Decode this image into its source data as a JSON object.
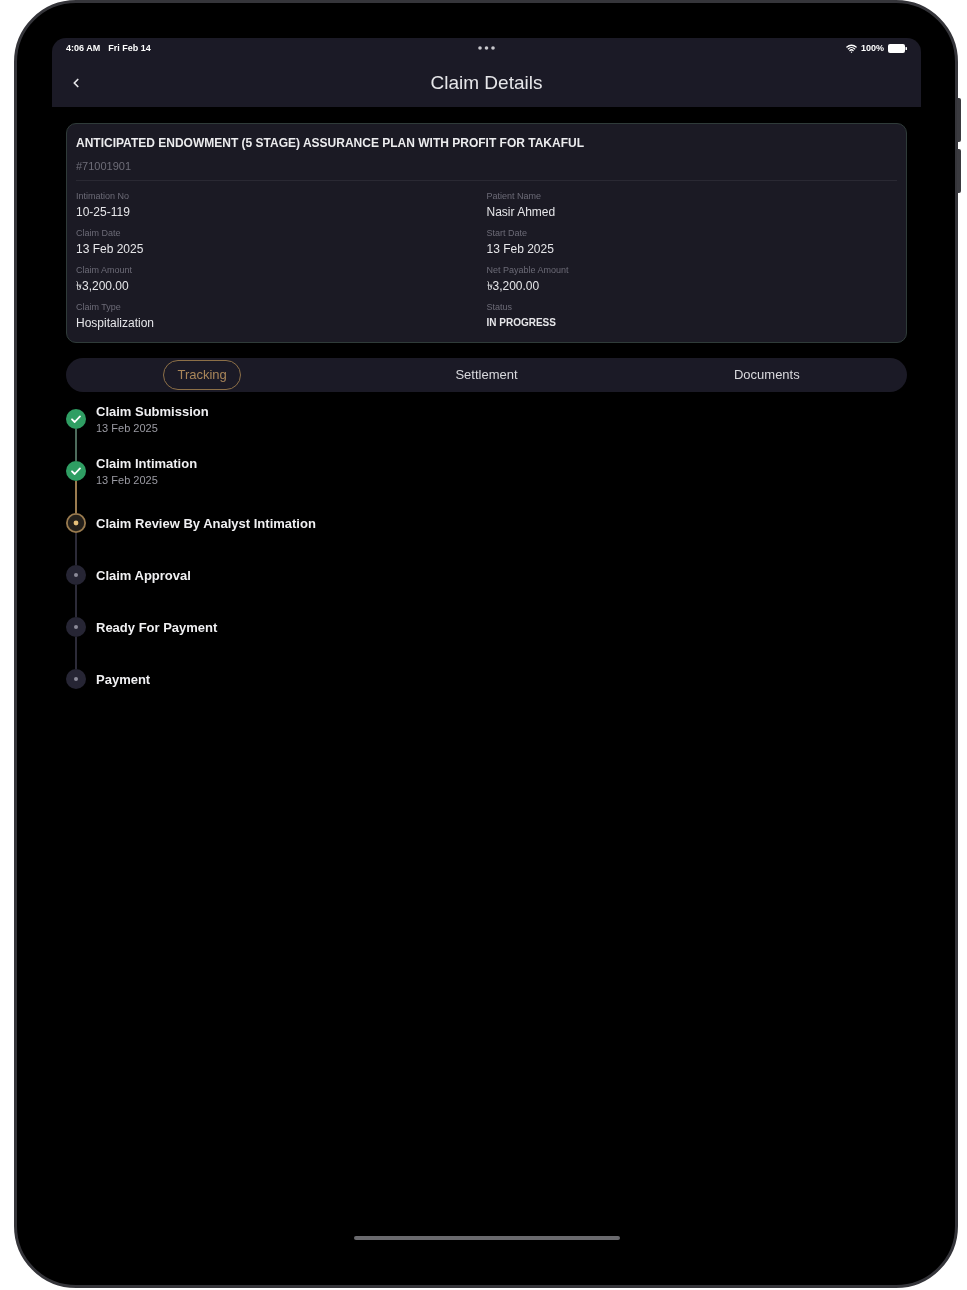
{
  "status_bar": {
    "time": "4:06 AM",
    "date": "Fri Feb 14",
    "battery": "100%"
  },
  "nav_bar": {
    "title": "Claim Details"
  },
  "claim_card": {
    "title": "ANTICIPATED ENDOWMENT (5 STAGE) ASSURANCE PLAN WITH PROFIT FOR TAKAFUL",
    "number": "#71001901",
    "fields": [
      {
        "label": "Intimation No",
        "value": "10-25-119",
        "kind": "text"
      },
      {
        "label": "Patient Name",
        "value": "Nasir Ahmed",
        "kind": "text"
      },
      {
        "label": "Claim Date",
        "value": "13 Feb 2025",
        "kind": "text"
      },
      {
        "label": "Start Date",
        "value": "13 Feb 2025",
        "kind": "text"
      },
      {
        "label": "Claim Amount",
        "value": "৳3,200.00",
        "kind": "text"
      },
      {
        "label": "Net Payable Amount",
        "value": "৳3,200.00",
        "kind": "text"
      },
      {
        "label": "Claim Type",
        "value": "Hospitalization",
        "kind": "text"
      },
      {
        "label": "Status",
        "value": "IN PROGRESS",
        "kind": "status"
      }
    ]
  },
  "tabs": [
    {
      "label": "Tracking",
      "selected": true
    },
    {
      "label": "Settlement",
      "selected": false
    },
    {
      "label": "Documents",
      "selected": false
    }
  ],
  "timeline": [
    {
      "title": "Claim Submission",
      "date": "13 Feb 2025",
      "completed": true,
      "current": false
    },
    {
      "title": "Claim Intimation",
      "date": "13 Feb 2025",
      "completed": true,
      "current": false
    },
    {
      "title": "Claim Review By Analyst Intimation",
      "completed": false,
      "current": true
    },
    {
      "title": "Claim Approval",
      "completed": false,
      "current": false
    },
    {
      "title": "Ready For Payment",
      "completed": false,
      "current": false
    },
    {
      "title": "Payment",
      "completed": false,
      "current": false
    }
  ]
}
